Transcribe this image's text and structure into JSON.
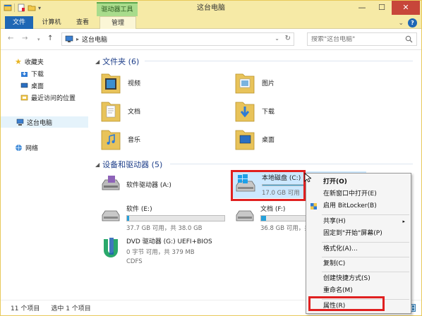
{
  "window": {
    "title": "这台电脑",
    "contextual_tab_group": "驱动器工具",
    "controls": {
      "minimize": "—",
      "maximize": "☐",
      "close": "✕"
    }
  },
  "ribbon": {
    "tabs": [
      "文件",
      "计算机",
      "查看",
      "管理"
    ],
    "chevron": "⌄",
    "help": "?"
  },
  "address": {
    "back": "←",
    "forward": "→",
    "up": "↑",
    "crumb": "这台电脑",
    "breadcrumb_sep": "▸",
    "dropdown": "⌄",
    "refresh": "↻"
  },
  "search": {
    "placeholder": "搜索\"这台电脑\""
  },
  "navpane": {
    "favorites": "收藏夹",
    "downloads": "下载",
    "desktop": "桌面",
    "recent": "最近访问的位置",
    "this_pc": "这台电脑",
    "network": "网络"
  },
  "folders_group": {
    "title": "文件夹 (6)"
  },
  "folders": [
    "视频",
    "图片",
    "文档",
    "下载",
    "音乐",
    "桌面"
  ],
  "drives_group": {
    "title": "设备和驱动器 (5)"
  },
  "drives": {
    "floppy": {
      "name": "软件驱动器 (A:)"
    },
    "c": {
      "name": "本地磁盘 (C:)",
      "free": "17.0 GB 可用",
      "used_fraction": 0.66
    },
    "e": {
      "name": "软件 (E:)",
      "free": "37.7 GB 可用，共 38.0 GB",
      "used_fraction": 0.02
    },
    "f": {
      "name": "文档 (F:)",
      "free": "36.8 GB 可用，共 38.0 GB",
      "used_fraction": 0.05
    },
    "dvd": {
      "name": "DVD 驱动器 (G:) UEFI+BIOS",
      "free": "0 字节 可用，共 379 MB",
      "fs": "CDFS"
    }
  },
  "context_menu": {
    "open": "打开(O)",
    "open_new_window": "在新窗口中打开(E)",
    "bitlocker": "启用 BitLocker(B)",
    "share": "共享(H)",
    "pin_start": "固定到\"开始\"屏幕(P)",
    "format": "格式化(A)...",
    "copy": "复制(C)",
    "shortcut": "创建快捷方式(S)",
    "rename": "重命名(M)",
    "properties": "属性(R)",
    "submenu_arrow": "▸"
  },
  "status": {
    "items": "11 个项目",
    "selected": "选中 1 个项目"
  },
  "colors": {
    "accent": "#1f67b5",
    "highlight": "#e02020",
    "drive_bar": "#26a0da",
    "contextual_tab": "#a9dc8c"
  }
}
